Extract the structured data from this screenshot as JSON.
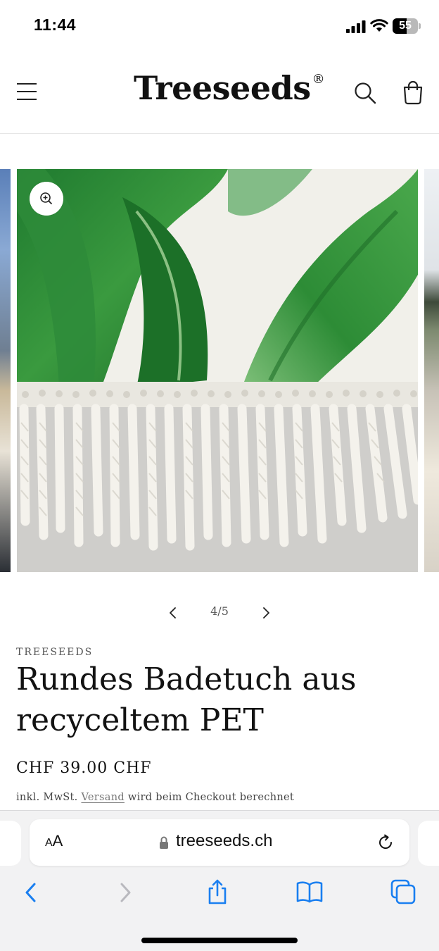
{
  "status_bar": {
    "time": "11:44",
    "battery_level": "55",
    "icons": [
      "signal-icon",
      "wifi-icon",
      "battery-icon"
    ]
  },
  "header": {
    "brand": "Treeseeds",
    "brand_mark": "®",
    "icons": [
      "hamburger-menu-icon",
      "search-icon",
      "cart-icon"
    ]
  },
  "gallery": {
    "current": "4/5",
    "main_image": "round beach towel with green leaf print and white cotton fringe",
    "icons": [
      "zoom-icon",
      "chevron-left-icon",
      "chevron-right-icon"
    ]
  },
  "product": {
    "vendor": "TREESEEDS",
    "title": "Rundes Badetuch aus recyceltem PET",
    "price": "CHF 39.00 CHF",
    "tax_prefix": "inkl. MwSt.",
    "shipping_link": "Versand",
    "tax_suffix": "wird beim Checkout berechnet"
  },
  "browser": {
    "text_size_small": "A",
    "text_size_big": "A",
    "url": "treeseeds.ch",
    "icons": [
      "lock-icon",
      "reload-icon",
      "back-icon",
      "forward-icon",
      "share-icon",
      "bookmarks-icon",
      "tabs-icon"
    ],
    "accent_color": "#1a7ff0",
    "disabled_color": "#b9b9be"
  }
}
